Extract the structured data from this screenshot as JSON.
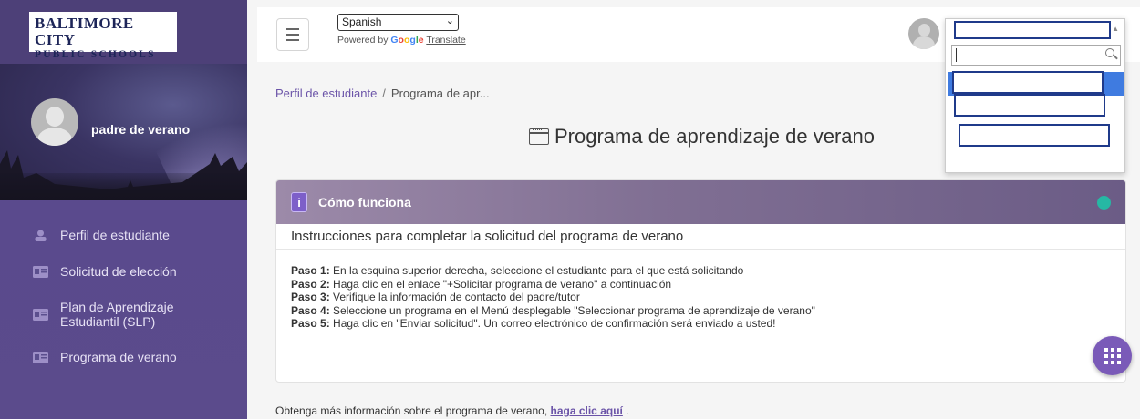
{
  "brand": {
    "line1": "BALTIMORE CITY",
    "line2": "PUBLIC SCHOOLS"
  },
  "user": {
    "name": "padre de verano"
  },
  "sidebar": {
    "items": [
      {
        "label": "Perfil de estudiante",
        "icon": "person-icon"
      },
      {
        "label": "Solicitud de elección",
        "icon": "id-card-icon"
      },
      {
        "label": "Plan de Aprendizaje Estudiantil (SLP)",
        "icon": "id-card-icon"
      },
      {
        "label": "Programa de verano",
        "icon": "id-card-icon"
      }
    ]
  },
  "topbar": {
    "language": "Spanish",
    "powered_prefix": "Powered by",
    "google": [
      "G",
      "o",
      "o",
      "g",
      "l",
      "e"
    ],
    "translate": "Translate"
  },
  "breadcrumb": {
    "home": "Perfil de estudiante",
    "separator": "/",
    "current": "Programa de apr..."
  },
  "page": {
    "title": "Programa de aprendizaje de verano"
  },
  "card": {
    "title": "Cómo funciona",
    "subtitle": "Instrucciones para completar la solicitud del programa de verano",
    "steps": [
      {
        "label": "Paso 1:",
        "text": " En la esquina superior derecha, seleccione el estudiante para el que está solicitando"
      },
      {
        "label": "Paso 2:",
        "text": " Haga clic en el enlace \"+Solicitar programa de verano\" a continuación"
      },
      {
        "label": "Paso 3:",
        "text": " Verifique la información de contacto del padre/tutor"
      },
      {
        "label": "Paso 4:",
        "text": " Seleccione un programa en el Menú desplegable \"Seleccionar programa de aprendizaje de verano\""
      },
      {
        "label": "Paso 5:",
        "text": " Haga clic en \"Enviar solicitud\". Un correo electrónico de confirmación será enviado a usted!"
      }
    ]
  },
  "footer": {
    "text": "Obtenga más información sobre el programa de verano, ",
    "link": "haga clic aquí",
    "tail": " ."
  },
  "colors": {
    "sidebar": "#5b4f8e",
    "accent": "#6b54a8",
    "status": "#26b8a4",
    "fab": "#7a5ab8"
  }
}
